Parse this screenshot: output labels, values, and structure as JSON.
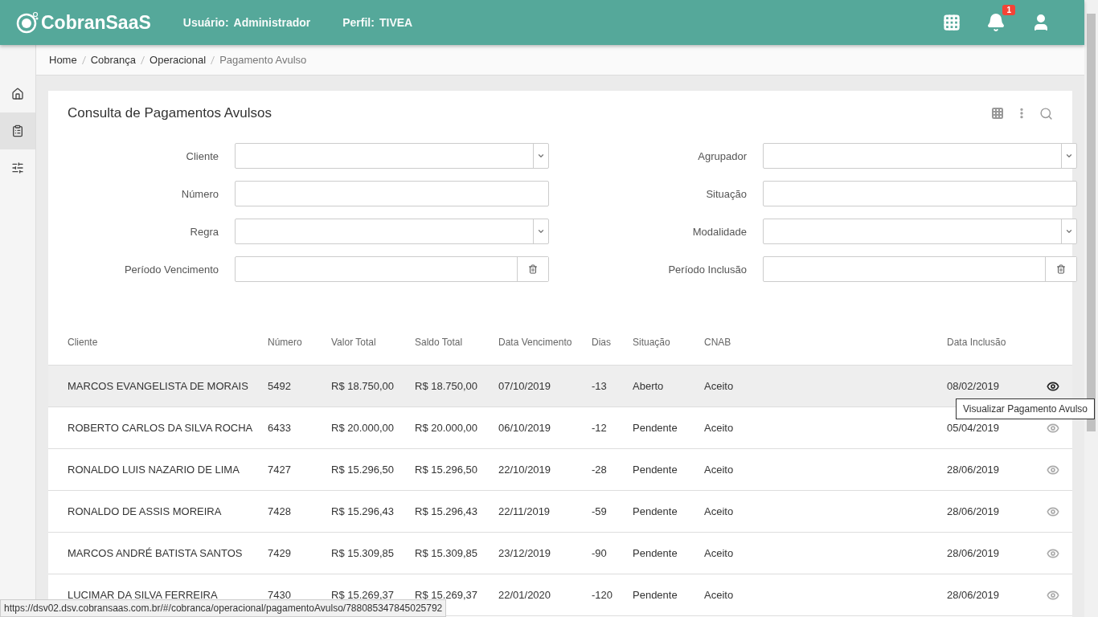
{
  "header": {
    "logo": "CobranSaaS",
    "user_label": "Usuário:",
    "user": "Administrador",
    "profile_label": "Perfil:",
    "profile": "TIVEA",
    "notification_count": "1"
  },
  "sidebar": {
    "items": [
      {
        "selected": false
      },
      {
        "selected": true
      },
      {
        "selected": false
      }
    ]
  },
  "breadcrumb": [
    "Home",
    "Cobrança",
    "Operacional",
    "Pagamento Avulso"
  ],
  "card": {
    "title": "Consulta de Pagamentos Avulsos"
  },
  "filters": [
    {
      "label": "Cliente",
      "kind": "select"
    },
    {
      "label": "Agrupador",
      "kind": "select"
    },
    {
      "label": "Número",
      "kind": "text"
    },
    {
      "label": "Situação",
      "kind": "text"
    },
    {
      "label": "Regra",
      "kind": "select"
    },
    {
      "label": "Modalidade",
      "kind": "select"
    },
    {
      "label": "Período Vencimento",
      "kind": "range"
    },
    {
      "label": "Período Inclusão",
      "kind": "range"
    }
  ],
  "table": {
    "columns": [
      "Cliente",
      "Número",
      "Valor Total",
      "Saldo Total",
      "Data Vencimento",
      "Dias",
      "Situação",
      "CNAB",
      "Data Inclusão"
    ],
    "rows": [
      {
        "cells": [
          "MARCOS EVANGELISTA DE MORAIS",
          "5492",
          "R$ 18.750,00",
          "R$ 18.750,00",
          "07/10/2019",
          "-13",
          "Aberto",
          "Aceito",
          "08/02/2019"
        ],
        "hovered": true
      },
      {
        "cells": [
          "ROBERTO CARLOS DA SILVA ROCHA",
          "6433",
          "R$ 20.000,00",
          "R$ 20.000,00",
          "06/10/2019",
          "-12",
          "Pendente",
          "Aceito",
          "05/04/2019"
        ],
        "hovered": false
      },
      {
        "cells": [
          "RONALDO LUIS NAZARIO DE LIMA",
          "7427",
          "R$ 15.296,50",
          "R$ 15.296,50",
          "22/10/2019",
          "-28",
          "Pendente",
          "Aceito",
          "28/06/2019"
        ],
        "hovered": false
      },
      {
        "cells": [
          "RONALDO DE ASSIS MOREIRA",
          "7428",
          "R$ 15.296,43",
          "R$ 15.296,43",
          "22/11/2019",
          "-59",
          "Pendente",
          "Aceito",
          "28/06/2019"
        ],
        "hovered": false
      },
      {
        "cells": [
          "MARCOS ANDRÉ BATISTA SANTOS",
          "7429",
          "R$ 15.309,85",
          "R$ 15.309,85",
          "23/12/2019",
          "-90",
          "Pendente",
          "Aceito",
          "28/06/2019"
        ],
        "hovered": false
      },
      {
        "cells": [
          "LUCIMAR DA SILVA FERREIRA",
          "7430",
          "R$ 15.269,37",
          "R$ 15.269,37",
          "22/01/2020",
          "-120",
          "Pendente",
          "Aceito",
          "28/06/2019"
        ],
        "hovered": false
      }
    ]
  },
  "tooltip": "Visualizar Pagamento Avulso",
  "status_url": "https://dsv02.dsv.cobransaas.com.br/#/cobranca/operacional/pagamentoAvulso/788085347845025792"
}
